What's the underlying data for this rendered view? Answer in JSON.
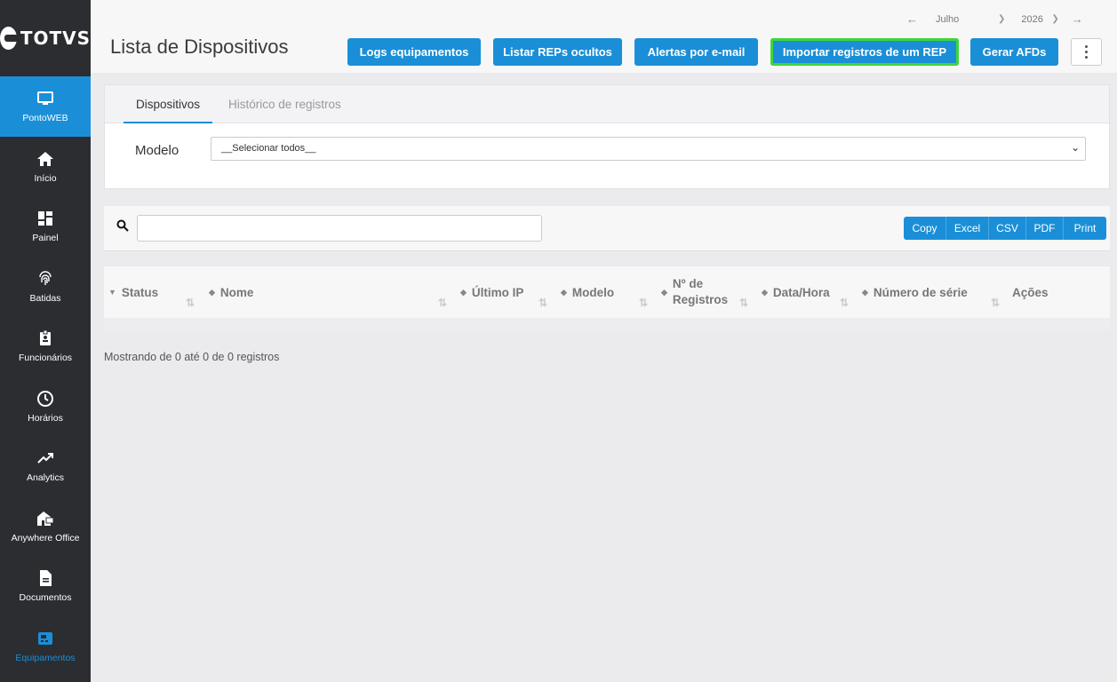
{
  "sidebar": {
    "logo": "TOTVS",
    "items": [
      {
        "label": "PontoWEB"
      },
      {
        "label": "Início"
      },
      {
        "label": "Painel"
      },
      {
        "label": "Batidas"
      },
      {
        "label": "Funcionários"
      },
      {
        "label": "Horários"
      },
      {
        "label": "Analytics"
      },
      {
        "label": "Anywhere Office"
      },
      {
        "label": "Documentos"
      },
      {
        "label": "Equipamentos"
      }
    ]
  },
  "header": {
    "title": "Lista de Dispositivos",
    "month": "Julho",
    "year": "2026",
    "buttons": {
      "logs": "Logs equipamentos",
      "hidden": "Listar REPs ocultos",
      "alerts": "Alertas por e-mail",
      "import": "Importar registros de um REP",
      "afd": "Gerar AFDs"
    }
  },
  "tabs": {
    "devices": "Dispositivos",
    "history": "Histórico de registros"
  },
  "filter": {
    "model_label": "Modelo",
    "model_value": "__Selecionar todos__"
  },
  "export": [
    "Copy",
    "Excel",
    "CSV",
    "PDF",
    "Print"
  ],
  "table": {
    "columns": {
      "status": "Status",
      "name": "Nome",
      "ip": "Último IP",
      "model": "Modelo",
      "records_1": "Nº de",
      "records_2": "Registros",
      "datetime": "Data/Hora",
      "serial": "Número de série",
      "actions": "Ações"
    }
  },
  "footer": {
    "info": "Mostrando de 0 até 0 de 0 registros"
  },
  "colors": {
    "accent": "#1a8fd8",
    "highlight": "#3fd63a",
    "sidebar": "#2b2d31"
  }
}
